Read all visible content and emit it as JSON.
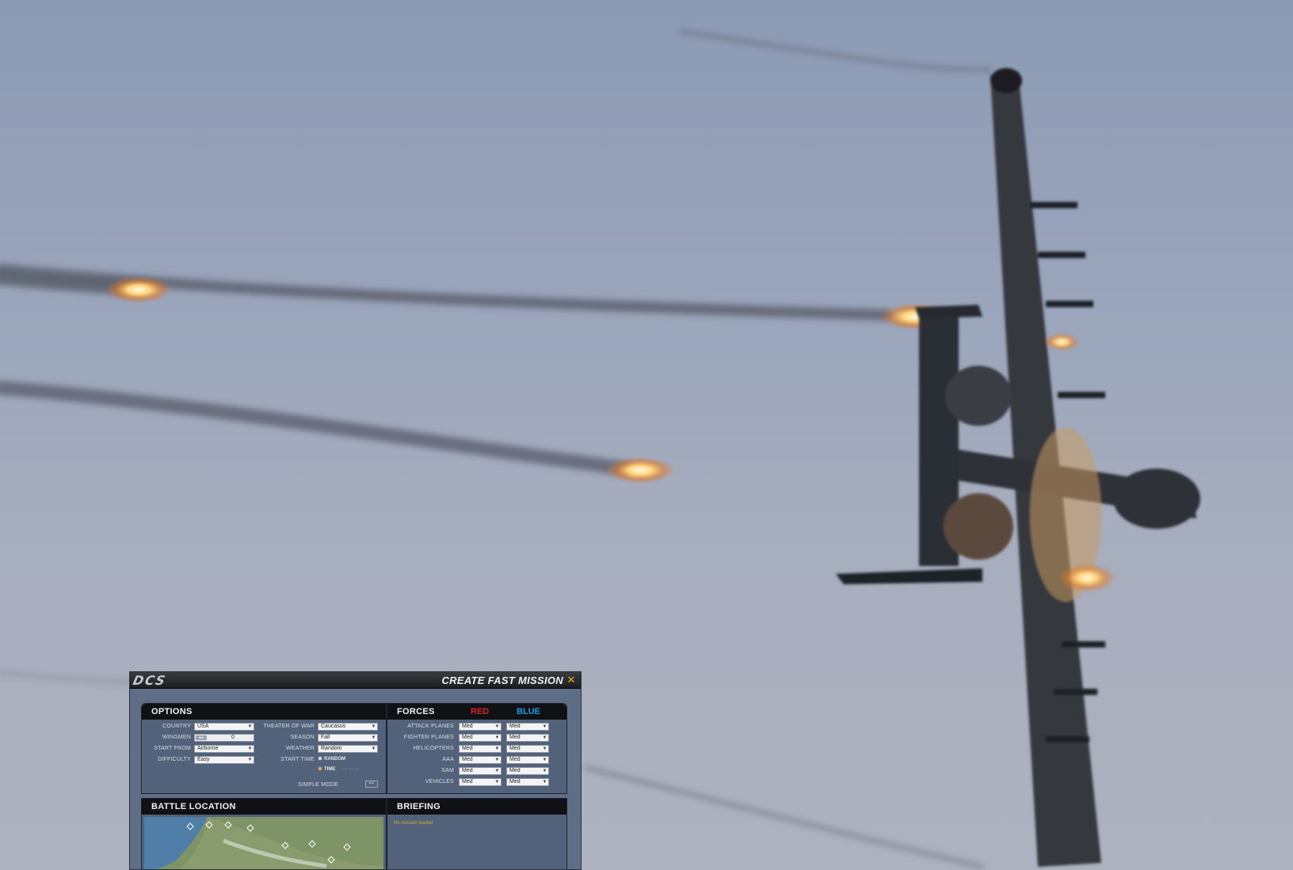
{
  "dialog": {
    "logo": "DCS",
    "title": "CREATE FAST MISSION",
    "close_icon": "close-icon"
  },
  "options": {
    "header": "OPTIONS",
    "country_label": "COUNTRY",
    "country_value": "USA",
    "wingmen_label": "WINGMEN",
    "wingmen_value": "0",
    "start_from_label": "START FROM",
    "start_from_value": "Airborne",
    "difficulty_label": "DIFFICULTY",
    "difficulty_value": "Easy",
    "theater_label": "THEATER OF WAR",
    "theater_value": "Caucasus",
    "season_label": "SEASON",
    "season_value": "Fall",
    "weather_label": "WEATHER",
    "weather_value": "Random",
    "start_time_label": "START TIME",
    "random_label": "RANDOM",
    "time_label": "TIME",
    "simple_mode_label": "SIMPLE MODE",
    "simple_mode_button": "<<"
  },
  "forces": {
    "header": "FORCES",
    "red_label": "RED",
    "blue_label": "BLUE",
    "red_color": "#d8232a",
    "blue_color": "#1e9ae0",
    "rows": [
      {
        "label": "ATTACK PLANES",
        "red": "Med",
        "blue": "Med"
      },
      {
        "label": "FIGHTER PLANES",
        "red": "Med",
        "blue": "Med"
      },
      {
        "label": "HELICOPTERS",
        "red": "Med",
        "blue": "Med"
      },
      {
        "label": "AAA",
        "red": "Med",
        "blue": "Med"
      },
      {
        "label": "SAM",
        "red": "Med",
        "blue": "Med"
      },
      {
        "label": "VEHICLES",
        "red": "Med",
        "blue": "Med"
      }
    ]
  },
  "battle_location": {
    "header": "BATTLE LOCATION"
  },
  "briefing": {
    "header": "BRIEFING",
    "text": "No mission loaded"
  }
}
